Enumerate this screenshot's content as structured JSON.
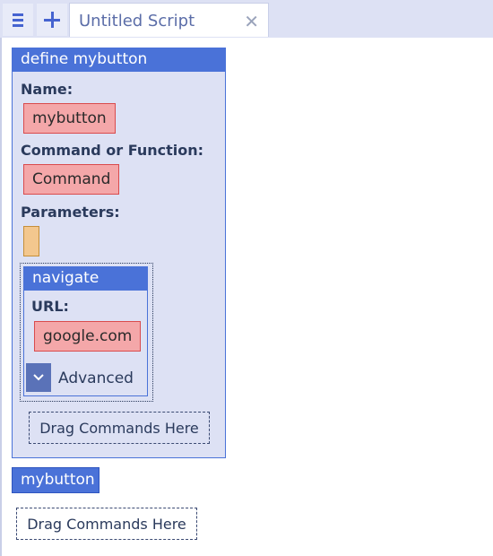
{
  "tabbar": {
    "menu_icon": "menu-icon",
    "add_icon": "plus-icon",
    "tab_title": "Untitled Script",
    "close_icon": "close-icon"
  },
  "define_block": {
    "header": "define mybutton",
    "name_label": "Name:",
    "name_value": "mybutton",
    "command_label": "Command or Function:",
    "command_value": "Command",
    "params_label": "Parameters:",
    "inner_command": {
      "header": "navigate",
      "url_label": "URL:",
      "url_value": "google.com",
      "advanced_icon": "chevron-down-icon",
      "advanced_label": "Advanced"
    },
    "drag_target_label": "Drag Commands Here"
  },
  "call_block": {
    "label": "mybutton"
  },
  "root_drag_target_label": "Drag Commands Here",
  "colors": {
    "accent": "#4a72d8",
    "block_bg": "#dde1f4",
    "field_red": "#f4a7a9",
    "param_orange": "#f3c78e"
  }
}
